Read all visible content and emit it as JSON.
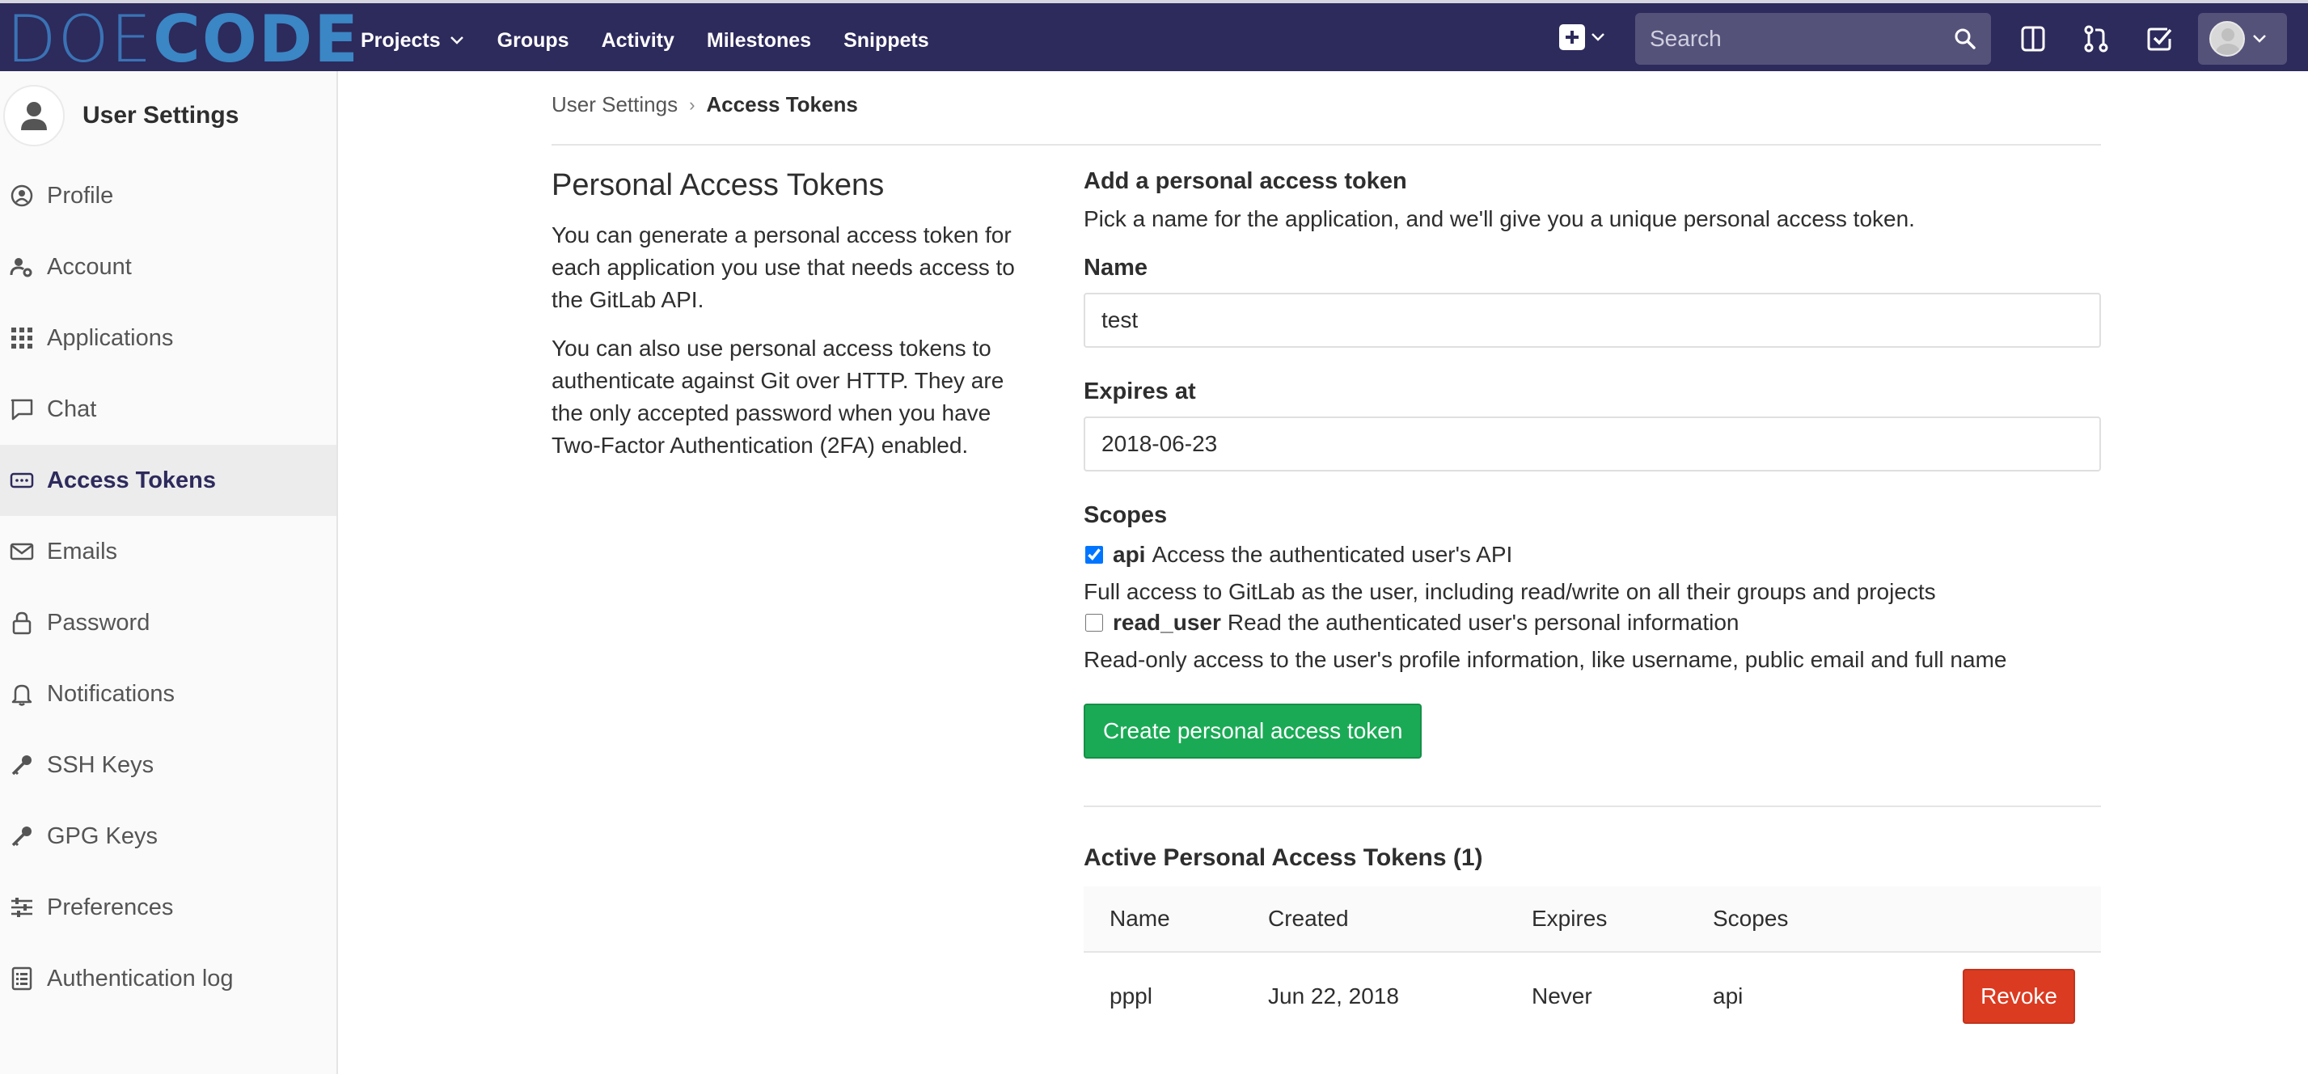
{
  "brand": {
    "logo_part1": "DOE",
    "logo_part2": "CODE"
  },
  "nav": {
    "links": [
      "Projects",
      "Groups",
      "Activity",
      "Milestones",
      "Snippets"
    ],
    "search_placeholder": "Search"
  },
  "sidebar": {
    "title": "User Settings",
    "items": [
      {
        "label": "Profile",
        "icon": "profile-icon"
      },
      {
        "label": "Account",
        "icon": "account-icon"
      },
      {
        "label": "Applications",
        "icon": "applications-icon"
      },
      {
        "label": "Chat",
        "icon": "chat-icon"
      },
      {
        "label": "Access Tokens",
        "icon": "access-tokens-icon",
        "active": true
      },
      {
        "label": "Emails",
        "icon": "email-icon"
      },
      {
        "label": "Password",
        "icon": "lock-icon"
      },
      {
        "label": "Notifications",
        "icon": "bell-icon"
      },
      {
        "label": "SSH Keys",
        "icon": "key-icon"
      },
      {
        "label": "GPG Keys",
        "icon": "key-icon"
      },
      {
        "label": "Preferences",
        "icon": "sliders-icon"
      },
      {
        "label": "Authentication log",
        "icon": "log-icon"
      }
    ]
  },
  "breadcrumb": {
    "parent": "User Settings",
    "current": "Access Tokens"
  },
  "intro": {
    "title": "Personal Access Tokens",
    "p1": "You can generate a personal access token for each application you use that needs access to the GitLab API.",
    "p2": "You can also use personal access tokens to authenticate against Git over HTTP. They are the only accepted password when you have Two-Factor Authentication (2FA) enabled."
  },
  "form": {
    "title": "Add a personal access token",
    "description": "Pick a name for the application, and we'll give you a unique personal access token.",
    "name_label": "Name",
    "name_value": "test",
    "expires_label": "Expires at",
    "expires_value": "2018-06-23",
    "scopes_label": "Scopes",
    "scopes": [
      {
        "name": "api",
        "summary": "Access the authenticated user's API",
        "help": "Full access to GitLab as the user, including read/write on all their groups and projects",
        "checked": true
      },
      {
        "name": "read_user",
        "summary": "Read the authenticated user's personal information",
        "help": "Read-only access to the user's profile information, like username, public email and full name",
        "checked": false
      }
    ],
    "submit_label": "Create personal access token"
  },
  "active_tokens": {
    "title": "Active Personal Access Tokens (1)",
    "headers": [
      "Name",
      "Created",
      "Expires",
      "Scopes"
    ],
    "rows": [
      {
        "name": "pppl",
        "created": "Jun 22, 2018",
        "expires": "Never",
        "scopes": "api",
        "action": "Revoke"
      }
    ]
  },
  "colors": {
    "navbar": "#2d2a5c",
    "primary_button": "#1aaa55",
    "danger_button": "#db3b21"
  }
}
